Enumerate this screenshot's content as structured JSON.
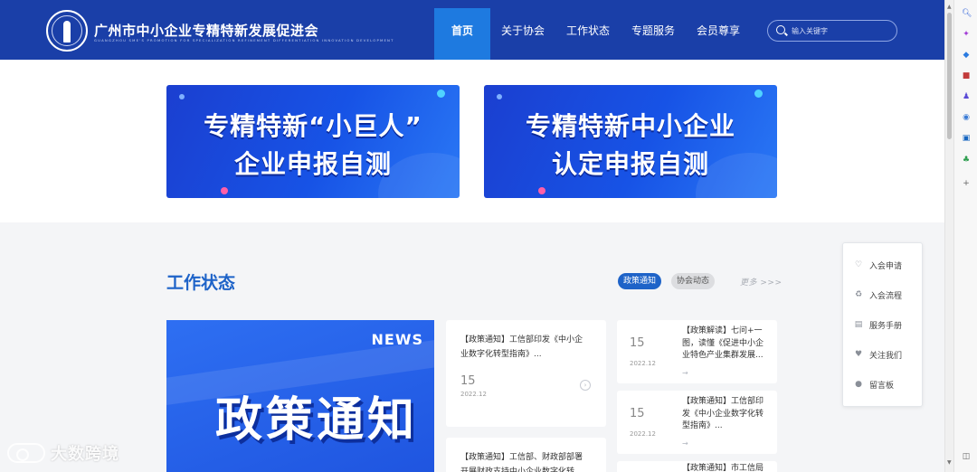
{
  "header": {
    "title": "广州市中小企业专精特新发展促进会",
    "subtitle": "GUANGZHOU SME'S PROMOTION FOR SPECIALIZATION REFINEMENT DIFFERENTIATION INNOVATION DEVELOPMENT",
    "nav": [
      {
        "label": "首页",
        "active": true
      },
      {
        "label": "关于协会",
        "active": false
      },
      {
        "label": "工作状态",
        "active": false
      },
      {
        "label": "专题服务",
        "active": false
      },
      {
        "label": "会员尊享",
        "active": false
      }
    ],
    "search_placeholder": "输入关键字"
  },
  "banners": [
    {
      "line1": "专精特新“小巨人”",
      "line2": "企业申报自测"
    },
    {
      "line1": "专精特新中小企业",
      "line2": "认定申报自测"
    }
  ],
  "work_status": {
    "title": "工作状态",
    "tabs": [
      "政策通知",
      "协会动态"
    ],
    "more": "更多 >>>",
    "feature": {
      "tag": "NEWS",
      "text": "政策通知"
    },
    "cards": [
      {
        "title": "【政策通知】工信部印发《中小企业数字化转型指南》...",
        "day": "15",
        "month": "2022.12"
      },
      {
        "title": "【政策通知】工信部、财政部部署开展财政支持中小企业数字化转..."
      }
    ],
    "side_cards": [
      {
        "day": "15",
        "month": "2022.12",
        "title": "【政策解读】七问+一图，读懂《促进中小企业特色产业集群发展..."
      },
      {
        "day": "15",
        "month": "2022.12",
        "title": "【政策通知】工信部印发《中小企业数字化转型指南》..."
      },
      {
        "title": "【政策通知】市工信局"
      }
    ]
  },
  "float_menu": [
    "入会申请",
    "入会流程",
    "服务手册",
    "关注我们",
    "留言板"
  ],
  "watermark": "大数跨境",
  "colors": {
    "header_bg": "#1a3fa8",
    "nav_active": "#1e7ae0",
    "accent": "#1e63c8"
  }
}
